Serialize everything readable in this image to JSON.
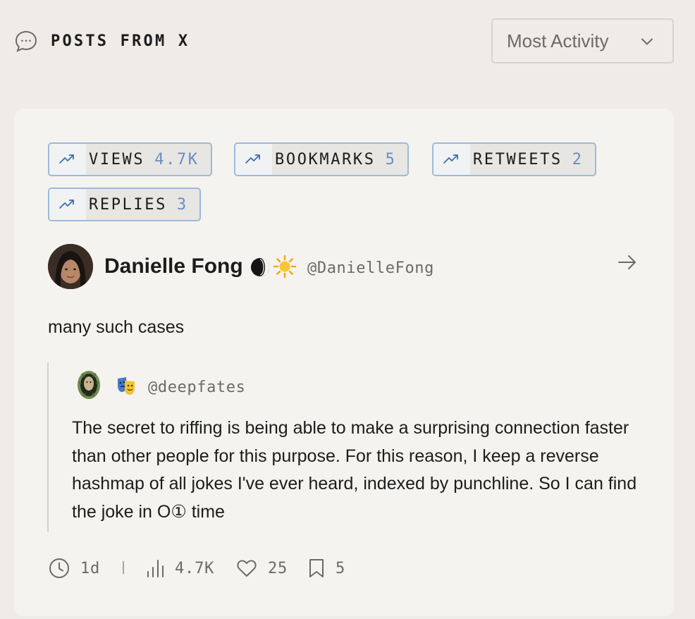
{
  "header": {
    "title": "POSTS FROM X",
    "icon": "chat-bubble-icon",
    "sort": {
      "selected": "Most Activity",
      "icon": "chevron-down-icon"
    }
  },
  "post": {
    "stats": [
      {
        "label": "VIEWS",
        "value": "4.7K",
        "icon": "trending-up-icon"
      },
      {
        "label": "BOOKMARKS",
        "value": "5",
        "icon": "trending-up-icon"
      },
      {
        "label": "RETWEETS",
        "value": "2",
        "icon": "trending-up-icon"
      },
      {
        "label": "REPLIES",
        "value": "3",
        "icon": "trending-up-icon"
      }
    ],
    "author": {
      "name": "Danielle Fong",
      "emojis": [
        "moon-icon",
        "sun-icon"
      ],
      "handle": "@DanielleFong"
    },
    "text": "many such cases",
    "quote": {
      "handle": "@deepfates",
      "emoji": "performing-arts-mask-icon",
      "text": "The secret to riffing is being able to make a surprising connection faster than other people for this purpose. For this reason, I keep a reverse hashmap of all jokes I've ever heard, indexed by punchline. So I can find the joke in O① time"
    },
    "footer": {
      "age": "1d",
      "views": "4.7K",
      "likes": "25",
      "bookmarks": "5"
    }
  },
  "colors": {
    "page_bg": "#efece8",
    "card_bg": "#f5f3ef",
    "accent_blue": "#6a8fbe",
    "chip_border": "#9cbadb",
    "muted_text": "#6d6a66"
  }
}
